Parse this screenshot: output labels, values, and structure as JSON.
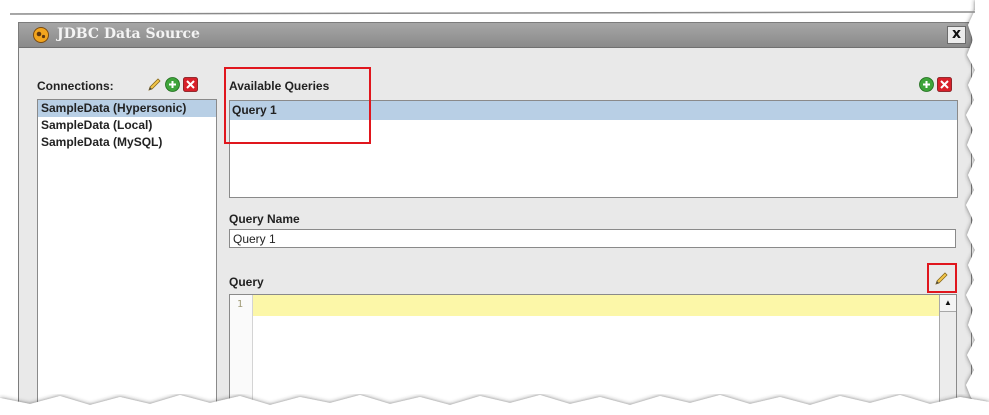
{
  "window": {
    "title": "JDBC Data Source",
    "close_label": "x"
  },
  "connections": {
    "label": "Connections:",
    "items": [
      {
        "label": "SampleData (Hypersonic)",
        "selected": true
      },
      {
        "label": "SampleData (Local)",
        "selected": false
      },
      {
        "label": "SampleData (MySQL)",
        "selected": false
      }
    ]
  },
  "queries": {
    "label": "Available Queries",
    "items": [
      {
        "label": "Query 1",
        "selected": true
      }
    ]
  },
  "query_name": {
    "label": "Query Name",
    "value": "Query 1"
  },
  "query": {
    "label": "Query",
    "line_number": "1"
  },
  "colors": {
    "selection": "#b8cfe5",
    "highlight_line": "#fcf7a8",
    "annotation_red": "#e0161d",
    "add_green": "#3ea43a",
    "remove_red": "#d8202a"
  },
  "icons": {
    "edit": "pencil-icon",
    "add": "green-plus-icon",
    "remove": "red-x-icon",
    "app": "pentaho-icon"
  }
}
